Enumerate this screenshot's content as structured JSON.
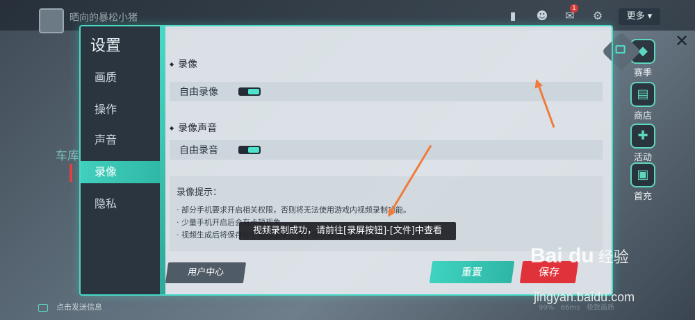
{
  "background": {
    "player_name": "晒向的暴松小猪",
    "more_label": "更多",
    "mail_badge": "1",
    "left_label": "车库",
    "chat_placeholder": "点击发送信息",
    "status": [
      "99%",
      "66ms",
      "极致画质"
    ],
    "side_items": [
      {
        "label": "赛季",
        "icon": "season-icon"
      },
      {
        "label": "商店",
        "icon": "shop-icon"
      },
      {
        "label": "活动",
        "icon": "gamepad-icon"
      },
      {
        "label": "首充",
        "icon": "gift-icon"
      }
    ]
  },
  "dialog": {
    "title": "设置",
    "nav": [
      {
        "label": "画质",
        "active": false
      },
      {
        "label": "操作",
        "active": false
      },
      {
        "label": "声音",
        "active": false
      },
      {
        "label": "录像",
        "active": true
      },
      {
        "label": "隐私",
        "active": false
      }
    ],
    "sections": [
      {
        "heading": "录像",
        "row_label": "自由录像",
        "toggle_on": true
      },
      {
        "heading": "录像声音",
        "row_label": "自由录音",
        "toggle_on": true
      }
    ],
    "tips": {
      "title": "录像提示：",
      "lines": [
        "· 部分手机要求开启相关权限，否则将无法使用游戏内视频录制功能。",
        "· 少量手机开启后会有卡顿现象。",
        "· 视频生成后将保存在手机相册中，便于您反复观看和分享。"
      ]
    },
    "buttons": {
      "user_center": "用户中心",
      "reset": "重置",
      "save": "保存",
      "close": "✕"
    }
  },
  "toast": "视频录制成功，请前往[录屏按钮]-[文件]中查看",
  "watermark": {
    "logo": "Bai du",
    "sub": "经验",
    "url": "jingyan.baidu.com"
  },
  "colors": {
    "accent": "#49d9c6",
    "danger": "#e0323a",
    "arrow": "#f07a3a"
  }
}
